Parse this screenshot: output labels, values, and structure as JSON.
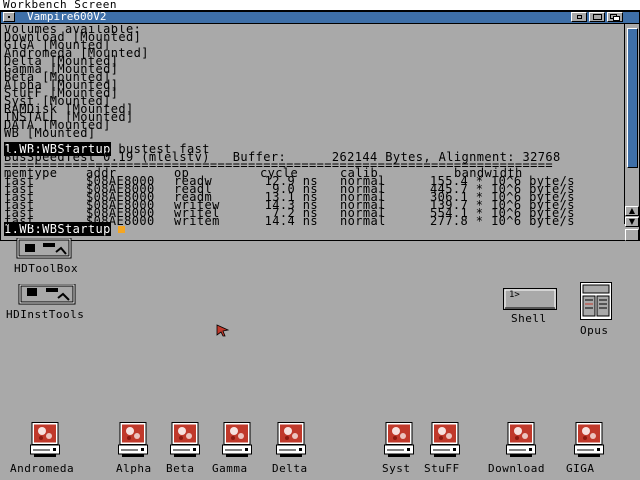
{
  "screen": {
    "title": "Workbench Screen"
  },
  "window": {
    "title": "Vampire600V2",
    "lines": [
      "Volumes available:",
      "Download [Mounted]",
      "GIGA [Mounted]",
      "Andromeda [Mounted]",
      "Delta [Mounted]",
      "Gamma [Mounted]",
      "Beta [Mounted]",
      "Alpha [Mounted]",
      "StuFF [Mounted]",
      "Syst [Mounted]",
      "RAMDisk [Mounted]",
      "INSTALL [Mounted]",
      "DATA [Mounted]",
      "WB [Mounted]"
    ],
    "prompt": "1.WB:WBStartup",
    "command": " bustest fast",
    "banner": "BusSpeedTest 0.19 (mlelstv)   Buffer:      262144 Bytes, Alignment: 32768",
    "separator": "========================================================================",
    "table": {
      "headers": [
        "memtype",
        "addr",
        "op",
        "cycle",
        "calib",
        "bandwidth"
      ],
      "rows": [
        [
          "fast",
          "$08AE8000",
          "readw",
          "12.9 ns",
          "normal",
          "155.4 * 10^6 byte/s"
        ],
        [
          "fast",
          "$08AE8000",
          "readl",
          "9.0 ns",
          "normal",
          "445.7 * 10^6 byte/s"
        ],
        [
          "fast",
          "$08AE8000",
          "readm",
          "13.1 ns",
          "normal",
          "306.1 * 10^6 byte/s"
        ],
        [
          "fast",
          "$08AE8000",
          "writew",
          "14.3 ns",
          "normal",
          "139.7 * 10^6 byte/s"
        ],
        [
          "fast",
          "$08AE8000",
          "writel",
          "7.2 ns",
          "normal",
          "554.1 * 10^6 byte/s"
        ],
        [
          "fast",
          "$08AE8000",
          "writem",
          "14.4 ns",
          "normal",
          "277.8 * 10^6 byte/s"
        ]
      ]
    },
    "final_prompt": "1.WB:WBStartup"
  },
  "desktop_icons": {
    "hdtoolbox": "HDToolBox",
    "hdinsttools": "HDInstTools",
    "shell": "Shell",
    "shell_prompt": "1>",
    "opus": "Opus",
    "drives": [
      "Andromeda",
      "Alpha",
      "Beta",
      "Gamma",
      "Delta",
      "Syst",
      "StuFF",
      "Download",
      "GIGA"
    ]
  },
  "colors": {
    "background": "#a9a9a9",
    "title_active": "#3e6fa8",
    "cursor": "#f5a623",
    "pointer": "#c0392b"
  }
}
